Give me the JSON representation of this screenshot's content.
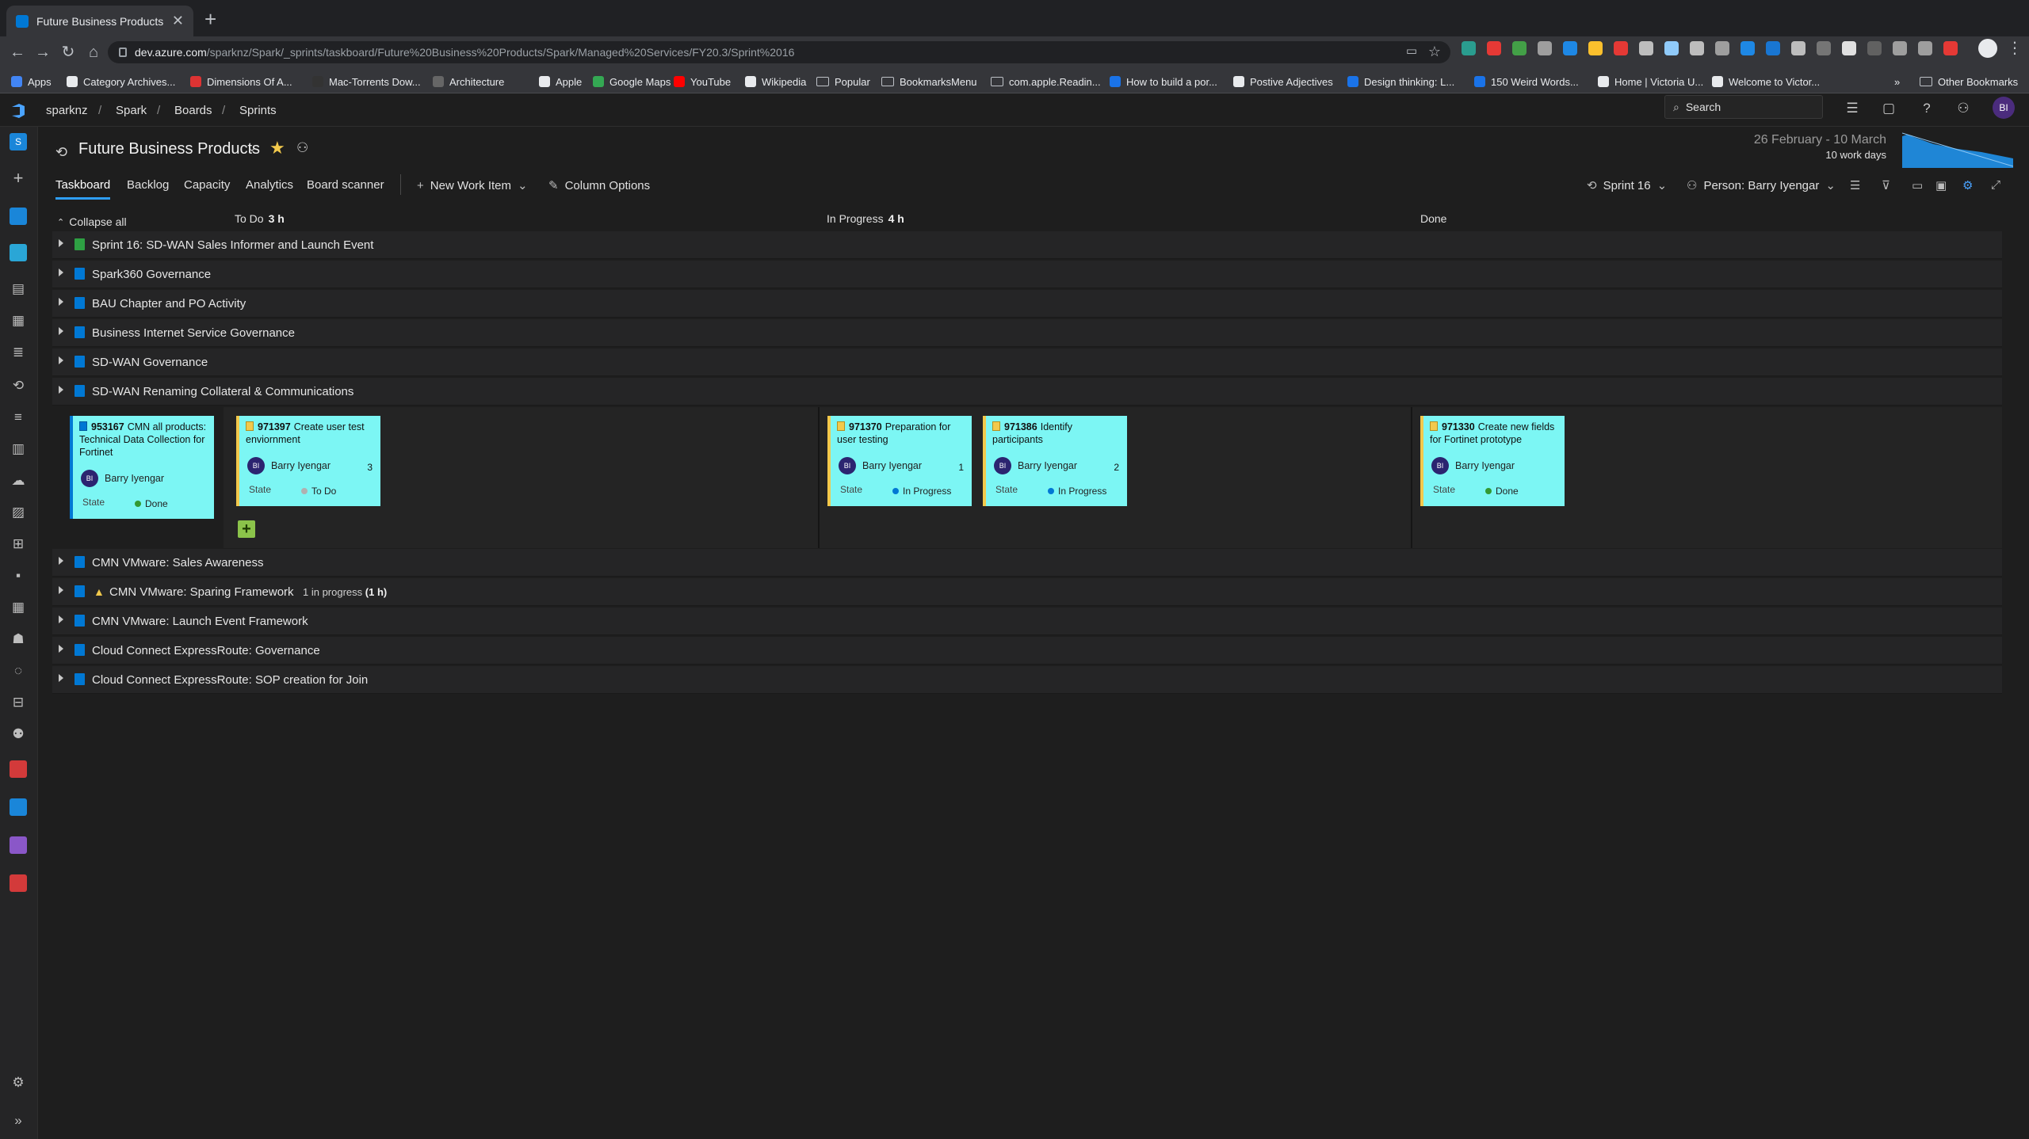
{
  "browser": {
    "tab_title": "Future Business Products Sprin",
    "url_host": "dev.azure.com",
    "url_path": "/sparknz/Spark/_sprints/taskboard/Future%20Business%20Products/Spark/Managed%20Services/FY20.3/Sprint%2016",
    "bookmarks": [
      "Apps",
      "Category Archives...",
      "Dimensions Of A...",
      "Mac-Torrents Dow...",
      "Architecture",
      "Apple",
      "Google Maps",
      "YouTube",
      "Wikipedia",
      "Popular",
      "BookmarksMenu",
      "com.apple.Readin...",
      "How to build a por...",
      "Postive Adjectives",
      "Design thinking: L...",
      "150 Weird Words...",
      "Home | Victoria U...",
      "Welcome to Victor..."
    ],
    "other_bookmarks": "Other Bookmarks"
  },
  "header": {
    "breadcrumb": [
      "sparknz",
      "Spark",
      "Boards",
      "Sprints"
    ],
    "search_label": "Search",
    "user_initials": "BI"
  },
  "page": {
    "title": "Future Business Products",
    "sprint_dates": "26 February - 10 March",
    "work_days": "10 work days",
    "pivots": [
      "Taskboard",
      "Backlog",
      "Capacity",
      "Analytics",
      "Board scanner"
    ],
    "new_work_item": "New Work Item",
    "column_options": "Column Options",
    "sprint_picker": "Sprint 16",
    "person_filter": "Person: Barry Iyengar"
  },
  "board": {
    "collapse_all": "Collapse all",
    "columns": [
      {
        "name": "To Do",
        "hours": "3 h"
      },
      {
        "name": "In Progress",
        "hours": "4 h"
      },
      {
        "name": "Done",
        "hours": ""
      }
    ],
    "rows_top": [
      "Sprint 16: SD-WAN Sales Informer and Launch Event",
      "Spark360 Governance",
      "BAU Chapter and PO Activity",
      "Business Internet Service Governance",
      "SD-WAN Governance",
      "SD-WAN Renaming Collateral & Communications"
    ],
    "expanded_item": {
      "id": "953167",
      "title": "CMN all products: Technical Data Collection for Fortinet",
      "assignee": "Barry Iyengar",
      "state_label": "State",
      "state": "Done"
    },
    "tasks": [
      {
        "id": "971397",
        "title": "Create user test enviornment",
        "assignee": "Barry Iyengar",
        "remaining": "3",
        "state_label": "State",
        "state": "To Do"
      },
      {
        "id": "971370",
        "title": "Preparation for user testing",
        "assignee": "Barry Iyengar",
        "remaining": "1",
        "state_label": "State",
        "state": "In Progress"
      },
      {
        "id": "971386",
        "title": "Identify participants",
        "assignee": "Barry Iyengar",
        "remaining": "2",
        "state_label": "State",
        "state": "In Progress"
      },
      {
        "id": "971330",
        "title": "Create new fields for Fortinet prototype",
        "assignee": "Barry Iyengar",
        "remaining": "",
        "state_label": "State",
        "state": "Done"
      }
    ],
    "rows_bottom": [
      {
        "title": "CMN VMware: Sales Awareness",
        "warning": false,
        "note": "",
        "note_hours": ""
      },
      {
        "title": "CMN VMware: Sparing Framework",
        "warning": true,
        "note": "1 in progress",
        "note_hours": "(1 h)"
      },
      {
        "title": "CMN VMware: Launch Event Framework",
        "warning": false,
        "note": "",
        "note_hours": ""
      },
      {
        "title": "Cloud Connect ExpressRoute: Governance",
        "warning": false,
        "note": "",
        "note_hours": ""
      },
      {
        "title": "Cloud Connect ExpressRoute: SOP creation for Join",
        "warning": false,
        "note": "",
        "note_hours": ""
      }
    ]
  },
  "colors": {
    "accent": "#2f9ef6",
    "card_bg": "#7cf6f4",
    "task_stripe": "#f2c94c",
    "pbi_stripe": "#0078d4",
    "todo_dot": "#b0b0b0",
    "inprogress_dot": "#0078d4",
    "done_dot": "#339933"
  }
}
